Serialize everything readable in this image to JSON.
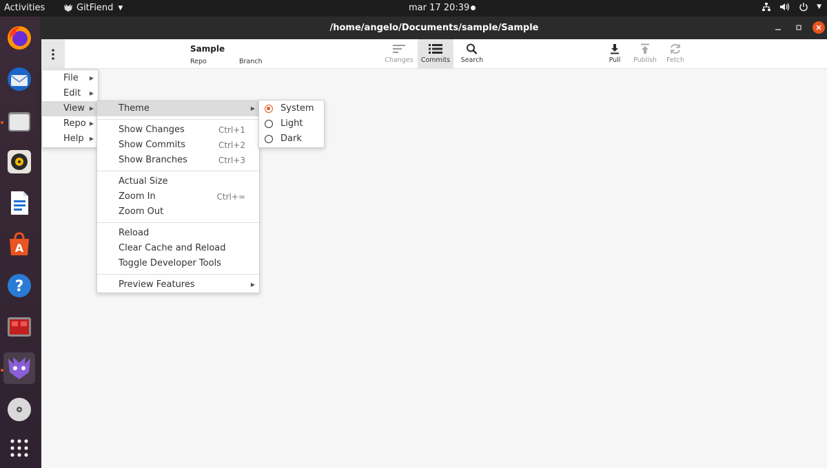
{
  "topbar": {
    "activities": "Activities",
    "app_name": "GitFiend",
    "clock": "mar 17  20:39"
  },
  "window": {
    "title": "/home/angelo/Documents/sample/Sample"
  },
  "toolbar": {
    "repo_name": "Sample",
    "repo_label": "Repo",
    "branch_label": "Branch",
    "changes": "Changes",
    "commits": "Commits",
    "search": "Search",
    "pull": "Pull",
    "publish": "Publish",
    "fetch": "Fetch"
  },
  "main_menu": {
    "items": [
      "File",
      "Edit",
      "View",
      "Repo",
      "Help"
    ]
  },
  "view_menu": {
    "theme": "Theme",
    "show_changes": "Show Changes",
    "show_changes_sc": "Ctrl+1",
    "show_commits": "Show Commits",
    "show_commits_sc": "Ctrl+2",
    "show_branches": "Show Branches",
    "show_branches_sc": "Ctrl+3",
    "actual_size": "Actual Size",
    "zoom_in": "Zoom In",
    "zoom_in_sc": "Ctrl+=",
    "zoom_out": "Zoom Out",
    "reload": "Reload",
    "clear_cache": "Clear Cache and Reload",
    "dev_tools": "Toggle Developer Tools",
    "preview": "Preview Features"
  },
  "theme_menu": {
    "system": "System",
    "light": "Light",
    "dark": "Dark",
    "selected": "System"
  },
  "colors": {
    "accent": "#e95420",
    "titlebar": "#2b2b2b",
    "window_bg": "#f6f6f6"
  }
}
